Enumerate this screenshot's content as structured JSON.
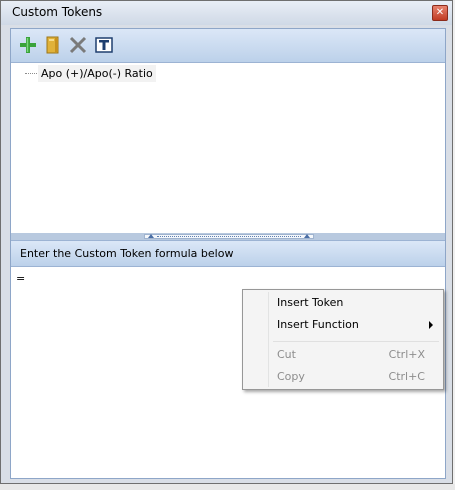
{
  "window": {
    "title": "Custom Tokens",
    "close_label": "✕"
  },
  "toolbar": {
    "buttons": [
      {
        "name": "add-icon"
      },
      {
        "name": "folder-icon"
      },
      {
        "name": "delete-icon"
      },
      {
        "name": "text-icon"
      }
    ]
  },
  "tree": {
    "items": [
      {
        "label": "Apo (+)/Apo(-) Ratio"
      }
    ]
  },
  "formula": {
    "header": "Enter the Custom Token formula below",
    "value": "="
  },
  "context_menu": {
    "items": [
      {
        "label": "Insert Token",
        "shortcut": "",
        "enabled": true
      },
      {
        "label": "Insert Function",
        "shortcut": "",
        "enabled": true,
        "submenu": true
      },
      {
        "label": "Cut",
        "shortcut": "Ctrl+X",
        "enabled": false
      },
      {
        "label": "Copy",
        "shortcut": "Ctrl+C",
        "enabled": false
      }
    ]
  },
  "colors": {
    "toolbar_gradient_top": "#dbe7f7",
    "toolbar_gradient_bottom": "#bcd1ea",
    "add_icon": "#3aa33a",
    "folder_icon": "#e0b23a",
    "delete_icon": "#7a7a7a",
    "text_icon": "#1f3f6f"
  }
}
